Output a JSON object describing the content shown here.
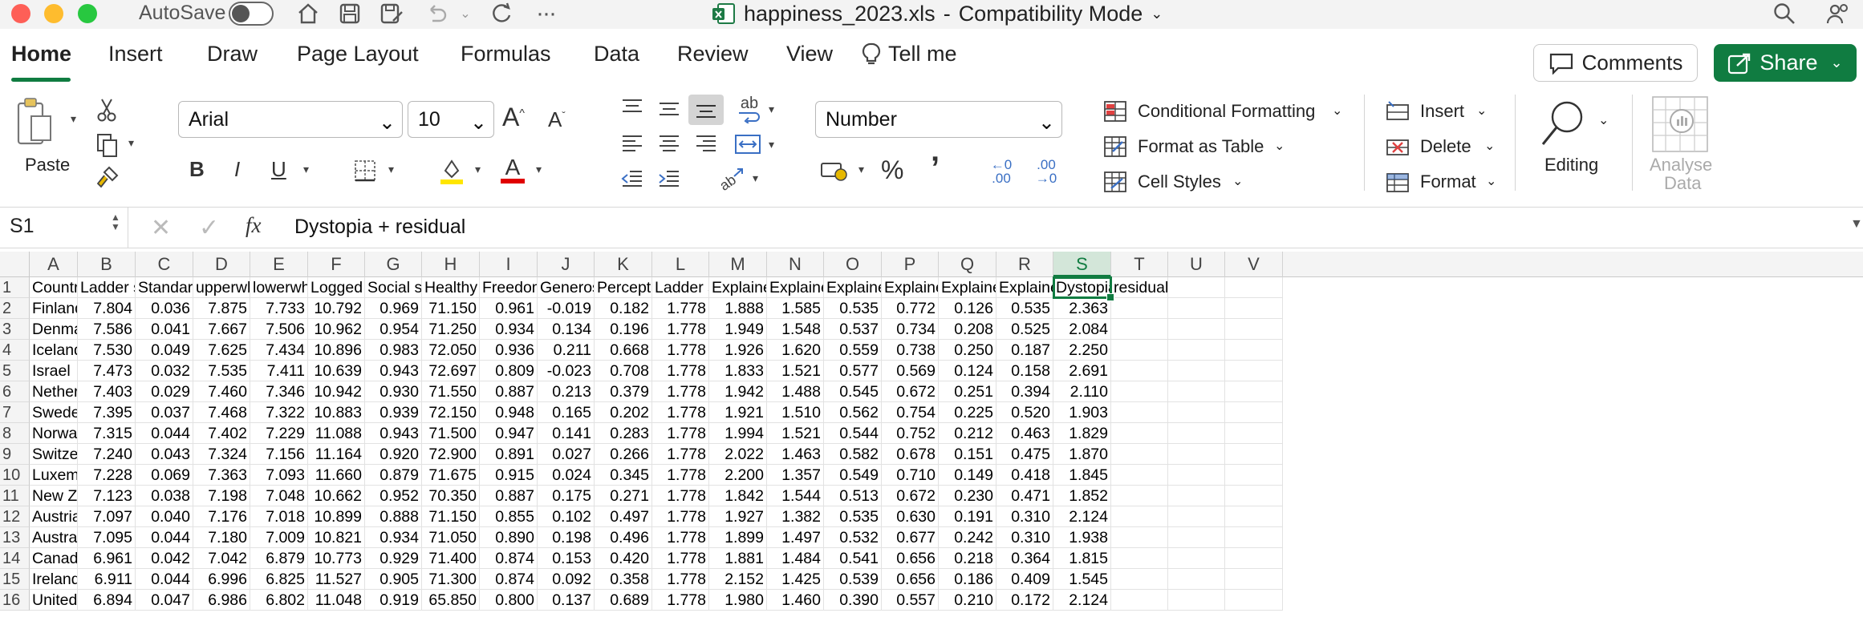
{
  "titlebar": {
    "autosave_label": "AutoSave",
    "filename": "happiness_2023.xls",
    "separator": "-",
    "mode": "Compatibility Mode",
    "autosave_on": false
  },
  "tabs": [
    "Home",
    "Insert",
    "Draw",
    "Page Layout",
    "Formulas",
    "Data",
    "Review",
    "View",
    "Tell me"
  ],
  "active_tab": "Home",
  "buttons": {
    "comments": "Comments",
    "share": "Share"
  },
  "ribbon": {
    "paste": "Paste",
    "font_name": "Arial",
    "font_size": "10",
    "number_format": "Number",
    "conditional_formatting": "Conditional Formatting",
    "format_as_table": "Format as Table",
    "cell_styles": "Cell Styles",
    "insert": "Insert",
    "delete": "Delete",
    "format": "Format",
    "editing": "Editing",
    "analyse_data_1": "Analyse",
    "analyse_data_2": "Data",
    "bold": "B",
    "italic": "I",
    "underline": "U",
    "font_color_letter": "A",
    "increase_font": "A",
    "decrease_font": "A",
    "percent": "%",
    "comma": "’",
    "inc_dec_top": "←0",
    "inc_dec_bot": ".00",
    "dec_dec_top": ".00",
    "dec_dec_bot": "→0",
    "wrap_text": "ab",
    "colors": {
      "accent": "#107c41",
      "highlight": "#ffe600",
      "font_color": "#e00000"
    }
  },
  "formula_bar": {
    "name_box": "S1",
    "fx": "fx",
    "content": "Dystopia + residual"
  },
  "sheet": {
    "columns": [
      "A",
      "B",
      "C",
      "D",
      "E",
      "F",
      "G",
      "H",
      "I",
      "J",
      "K",
      "L",
      "M",
      "N",
      "O",
      "P",
      "Q",
      "R",
      "S",
      "T",
      "U",
      "V"
    ],
    "active_column": "S",
    "header_row": [
      "Country na",
      "Ladder sco",
      "Standard e",
      "upperwhisk",
      "lowerwhisk",
      "Logged GD",
      "Social supp",
      "Healthy life",
      "Freedom to",
      "Generosity",
      "Perception",
      "Ladder sco",
      "Explained",
      "Explained",
      "Explained",
      "Explained",
      "Explained",
      "Explained",
      "Dystopia + ",
      "residual"
    ],
    "rows": [
      [
        "Finland",
        "7.804",
        "0.036",
        "7.875",
        "7.733",
        "10.792",
        "0.969",
        "71.150",
        "0.961",
        "-0.019",
        "0.182",
        "1.778",
        "1.888",
        "1.585",
        "0.535",
        "0.772",
        "0.126",
        "0.535",
        "2.363"
      ],
      [
        "Denmark",
        "7.586",
        "0.041",
        "7.667",
        "7.506",
        "10.962",
        "0.954",
        "71.250",
        "0.934",
        "0.134",
        "0.196",
        "1.778",
        "1.949",
        "1.548",
        "0.537",
        "0.734",
        "0.208",
        "0.525",
        "2.084"
      ],
      [
        "Iceland",
        "7.530",
        "0.049",
        "7.625",
        "7.434",
        "10.896",
        "0.983",
        "72.050",
        "0.936",
        "0.211",
        "0.668",
        "1.778",
        "1.926",
        "1.620",
        "0.559",
        "0.738",
        "0.250",
        "0.187",
        "2.250"
      ],
      [
        "Israel",
        "7.473",
        "0.032",
        "7.535",
        "7.411",
        "10.639",
        "0.943",
        "72.697",
        "0.809",
        "-0.023",
        "0.708",
        "1.778",
        "1.833",
        "1.521",
        "0.577",
        "0.569",
        "0.124",
        "0.158",
        "2.691"
      ],
      [
        "Netherland",
        "7.403",
        "0.029",
        "7.460",
        "7.346",
        "10.942",
        "0.930",
        "71.550",
        "0.887",
        "0.213",
        "0.379",
        "1.778",
        "1.942",
        "1.488",
        "0.545",
        "0.672",
        "0.251",
        "0.394",
        "2.110"
      ],
      [
        "Sweden",
        "7.395",
        "0.037",
        "7.468",
        "7.322",
        "10.883",
        "0.939",
        "72.150",
        "0.948",
        "0.165",
        "0.202",
        "1.778",
        "1.921",
        "1.510",
        "0.562",
        "0.754",
        "0.225",
        "0.520",
        "1.903"
      ],
      [
        "Norway",
        "7.315",
        "0.044",
        "7.402",
        "7.229",
        "11.088",
        "0.943",
        "71.500",
        "0.947",
        "0.141",
        "0.283",
        "1.778",
        "1.994",
        "1.521",
        "0.544",
        "0.752",
        "0.212",
        "0.463",
        "1.829"
      ],
      [
        "Switzerlanc",
        "7.240",
        "0.043",
        "7.324",
        "7.156",
        "11.164",
        "0.920",
        "72.900",
        "0.891",
        "0.027",
        "0.266",
        "1.778",
        "2.022",
        "1.463",
        "0.582",
        "0.678",
        "0.151",
        "0.475",
        "1.870"
      ],
      [
        "Luxembour",
        "7.228",
        "0.069",
        "7.363",
        "7.093",
        "11.660",
        "0.879",
        "71.675",
        "0.915",
        "0.024",
        "0.345",
        "1.778",
        "2.200",
        "1.357",
        "0.549",
        "0.710",
        "0.149",
        "0.418",
        "1.845"
      ],
      [
        "New Zealar",
        "7.123",
        "0.038",
        "7.198",
        "7.048",
        "10.662",
        "0.952",
        "70.350",
        "0.887",
        "0.175",
        "0.271",
        "1.778",
        "1.842",
        "1.544",
        "0.513",
        "0.672",
        "0.230",
        "0.471",
        "1.852"
      ],
      [
        "Austria",
        "7.097",
        "0.040",
        "7.176",
        "7.018",
        "10.899",
        "0.888",
        "71.150",
        "0.855",
        "0.102",
        "0.497",
        "1.778",
        "1.927",
        "1.382",
        "0.535",
        "0.630",
        "0.191",
        "0.310",
        "2.124"
      ],
      [
        "Australia",
        "7.095",
        "0.044",
        "7.180",
        "7.009",
        "10.821",
        "0.934",
        "71.050",
        "0.890",
        "0.198",
        "0.496",
        "1.778",
        "1.899",
        "1.497",
        "0.532",
        "0.677",
        "0.242",
        "0.310",
        "1.938"
      ],
      [
        "Canada",
        "6.961",
        "0.042",
        "7.042",
        "6.879",
        "10.773",
        "0.929",
        "71.400",
        "0.874",
        "0.153",
        "0.420",
        "1.778",
        "1.881",
        "1.484",
        "0.541",
        "0.656",
        "0.218",
        "0.364",
        "1.815"
      ],
      [
        "Ireland",
        "6.911",
        "0.044",
        "6.996",
        "6.825",
        "11.527",
        "0.905",
        "71.300",
        "0.874",
        "0.092",
        "0.358",
        "1.778",
        "2.152",
        "1.425",
        "0.539",
        "0.656",
        "0.186",
        "0.409",
        "1.545"
      ],
      [
        "United Stat",
        "6.894",
        "0.047",
        "6.986",
        "6.802",
        "11.048",
        "0.919",
        "65.850",
        "0.800",
        "0.137",
        "0.689",
        "1.778",
        "1.980",
        "1.460",
        "0.390",
        "0.557",
        "0.210",
        "0.172",
        "2.124"
      ]
    ]
  }
}
